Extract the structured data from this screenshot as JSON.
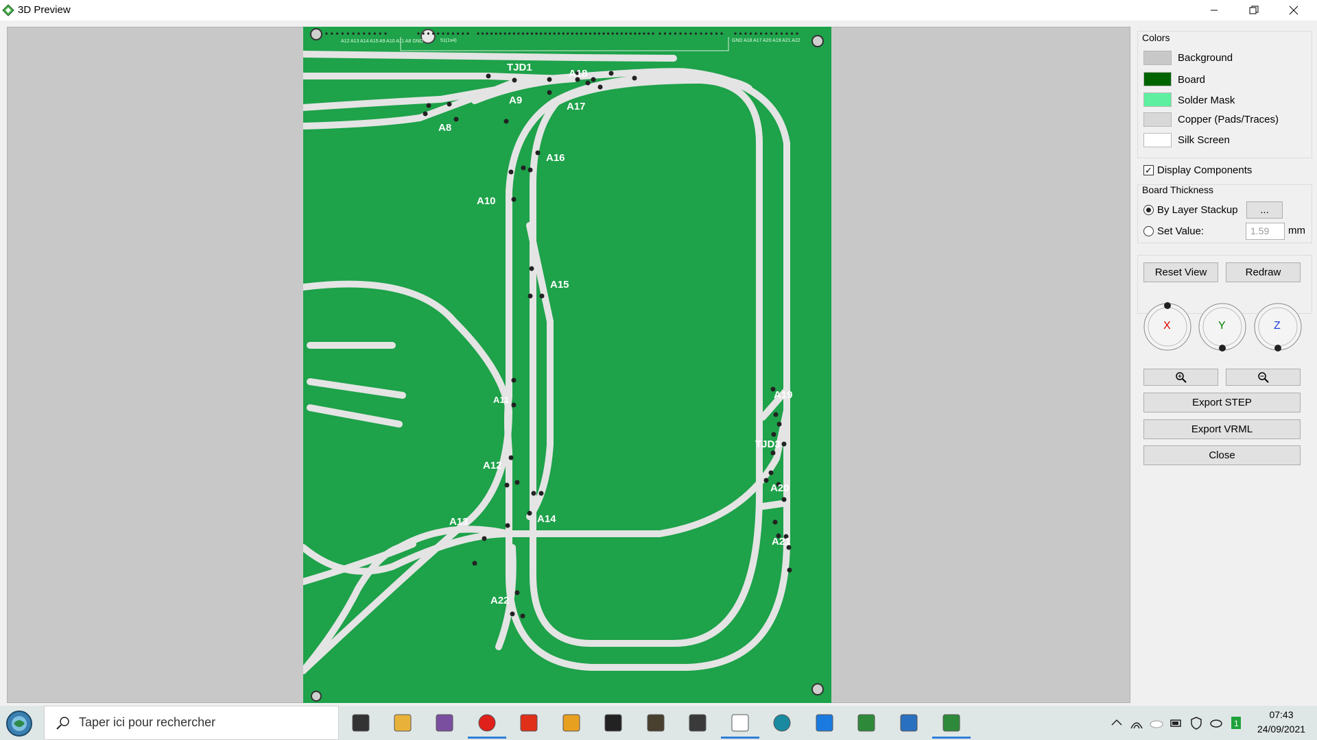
{
  "window": {
    "title": "3D Preview"
  },
  "board": {
    "colors": {
      "background": "#c8c8c8",
      "board": "#1ea24a",
      "track": "#e4e4e4",
      "hole": "#222222"
    },
    "labels": [
      "TJD1",
      "A18",
      "A9",
      "A17",
      "A8",
      "A16",
      "A10",
      "A15",
      "A11",
      "A12",
      "A13",
      "A14",
      "A22",
      "A19",
      "TJD3",
      "A20",
      "A21"
    ],
    "header_left_pins": [
      "A12",
      "A13",
      "A14",
      "A15",
      "A9",
      "A10",
      "A11",
      "A8",
      "GND"
    ],
    "header_right_pins": [
      "GND",
      "A18",
      "A17",
      "A20",
      "A19",
      "A21",
      "A22"
    ],
    "silk_mid": "51(1x4)"
  },
  "panel": {
    "colors_title": "Colors",
    "colors": [
      {
        "label": "Background",
        "color": "#c8c8c8"
      },
      {
        "label": "Board",
        "color": "#006400"
      },
      {
        "label": "Solder Mask",
        "color": "#5ef0a0"
      },
      {
        "label": "Copper (Pads/Traces)",
        "color": "#d8d8d8"
      },
      {
        "label": "Silk Screen",
        "color": "#ffffff"
      }
    ],
    "display_components": "Display Components",
    "board_thickness": "Board Thickness",
    "by_layer_stackup": "By Layer Stackup",
    "stackup_button": "...",
    "set_value": "Set Value:",
    "thickness_value": "1.59",
    "unit": "mm",
    "reset_view": "Reset View",
    "redraw": "Redraw",
    "axes": [
      {
        "label": "X",
        "color": "#e00000"
      },
      {
        "label": "Y",
        "color": "#008000"
      },
      {
        "label": "Z",
        "color": "#2040e0"
      }
    ],
    "export_step": "Export STEP",
    "export_vrml": "Export VRML",
    "close": "Close"
  },
  "taskbar": {
    "search_placeholder": "Taper ici pour rechercher",
    "time": "07:43",
    "date": "24/09/2021",
    "apps": [
      "task-view-icon",
      "file-explorer-icon",
      "winrar-icon",
      "opera-icon",
      "feather-app-icon",
      "paw-app-icon",
      "chip-app-icon",
      "dark-app-icon",
      "train-app-icon",
      "document-icon",
      "arduino-icon",
      "blue-star-app-icon",
      "pcb-app-icon",
      "blueprint-app-icon",
      "pcb-active-icon"
    ]
  }
}
